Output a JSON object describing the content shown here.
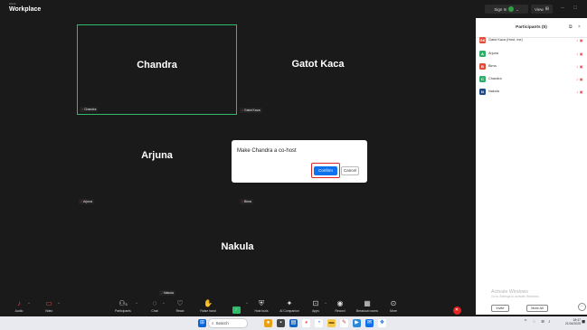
{
  "app": {
    "brand_sup": "zoom",
    "brand_name": "Workplace",
    "sign_in": "Sign In",
    "view": "View",
    "view_icon": "grid-icon",
    "accent": "#2dbb6a"
  },
  "gallery": {
    "tiles": [
      {
        "name": "Chandra",
        "tag": "Chandra",
        "active": true
      },
      {
        "name": "Gatot Kaca",
        "tag": "Gatot Kaca",
        "active": false
      },
      {
        "name": "Arjuna",
        "tag": "Arjuna",
        "active": false
      },
      {
        "name": "",
        "tag": "Bima",
        "active": false
      },
      {
        "name": "Nakula",
        "tag": "Nakula",
        "active": false
      }
    ]
  },
  "dialog": {
    "message": "Make Chandra a co-host",
    "confirm": "Confirm",
    "cancel": "Cancel",
    "highlight_color": "#e02424",
    "confirm_color": "#0e72ed"
  },
  "participants": {
    "title": "Participants (5)",
    "list": [
      {
        "initial": "GK",
        "name": "Gatot Kaca (Host, me)",
        "color": "#e14b3b"
      },
      {
        "initial": "A",
        "name": "Arjuna",
        "color": "#2fae6a"
      },
      {
        "initial": "B",
        "name": "Bima",
        "color": "#e14b3b"
      },
      {
        "initial": "C",
        "name": "Chandra",
        "color": "#2fae6a"
      },
      {
        "initial": "N",
        "name": "Nakula",
        "color": "#1e4a8a"
      }
    ],
    "activate_title": "Activate Windows",
    "activate_sub": "Go to Settings to activate Windows.",
    "invite": "Invite",
    "mute_all": "Mute All",
    "more": "···"
  },
  "toolbar": {
    "items": [
      {
        "label": "Audio",
        "icon": "mic-off-icon"
      },
      {
        "label": "Video",
        "icon": "video-off-icon"
      },
      {
        "label": "Participants",
        "icon": "participants-icon",
        "badge": "5"
      },
      {
        "label": "Chat",
        "icon": "chat-icon"
      },
      {
        "label": "React",
        "icon": "react-icon"
      },
      {
        "label": "Raise hand",
        "icon": "raise-hand-icon"
      },
      {
        "label": "Share",
        "icon": "share-icon"
      },
      {
        "label": "Host tools",
        "icon": "host-tools-icon"
      },
      {
        "label": "AI Companion",
        "icon": "ai-companion-icon"
      },
      {
        "label": "Apps",
        "icon": "apps-icon"
      },
      {
        "label": "Record",
        "icon": "record-icon"
      },
      {
        "label": "Breakout rooms",
        "icon": "breakout-rooms-icon"
      },
      {
        "label": "More",
        "icon": "more-icon"
      },
      {
        "label": "End",
        "icon": "end-icon"
      }
    ]
  },
  "taskbar": {
    "search": "Search",
    "time": "18:47",
    "date": "21/04/2025"
  }
}
